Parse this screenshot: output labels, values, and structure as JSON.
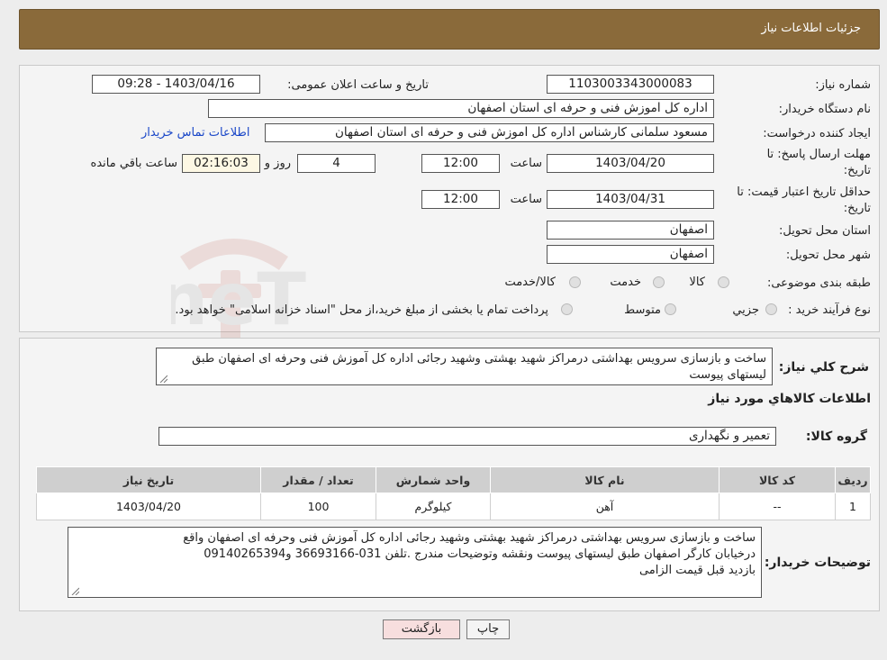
{
  "header": {
    "title": "جزئیات اطلاعات نیاز"
  },
  "form": {
    "need_number_label": "شماره نیاز:",
    "need_number": "1103003343000083",
    "announce_label": "تاریخ و ساعت اعلان عمومی:",
    "announce_value": "1403/04/16 - 09:28",
    "buyer_org_label": "نام دستگاه خریدار:",
    "buyer_org": "اداره کل اموزش فنی و حرفه ای استان اصفهان",
    "creator_label": "ایجاد کننده درخواست:",
    "creator": "مسعود سلمانی کارشناس اداره کل اموزش فنی و حرفه ای استان اصفهان",
    "contact_link": "اطلاعات تماس خریدار",
    "deadline_label_1": "مهلت ارسال پاسخ: تا",
    "deadline_label_2": "تاریخ:",
    "deadline_date": "1403/04/20",
    "time_label": "ساعت",
    "deadline_time": "12:00",
    "days_value": "4",
    "days_label": "روز و",
    "remaining_time": "02:16:03",
    "remaining_label": "ساعت باقي مانده",
    "validity_label_1": "حداقل تاریخ اعتبار قیمت: تا",
    "validity_label_2": "تاریخ:",
    "validity_date": "1403/04/31",
    "validity_time": "12:00",
    "province_label": "استان محل تحویل:",
    "province": "اصفهان",
    "city_label": "شهر محل تحویل:",
    "city": "اصفهان",
    "category_label": "طبقه بندی موضوعی:",
    "category_options": [
      "کالا",
      "خدمت",
      "کالا/خدمت"
    ],
    "process_label": "نوع فرآیند خرید :",
    "process_options": [
      "جزیي",
      "متوسط"
    ],
    "process_note": "پرداخت تمام یا بخشی از مبلغ خرید،از محل \"اسناد خزانه اسلامی\" خواهد بود."
  },
  "description": {
    "label": "شرح کلي نياز:",
    "text": "ساخت و بازسازی سرویس بهداشتی درمراکز شهید بهشتی وشهید رجائی اداره کل آموزش فنی وحرفه ای اصفهان طبق لیستهای پیوست"
  },
  "goods": {
    "section_title": "اطلاعات کالاهاي مورد نياز",
    "group_label": "گروه کالا:",
    "group_value": "تعمیر و نگهداری",
    "columns": [
      "رديف",
      "کد کالا",
      "نام کالا",
      "واحد شمارش",
      "تعداد / مقدار",
      "تاريخ نياز"
    ],
    "rows": [
      [
        "1",
        "--",
        "آهن",
        "کیلوگرم",
        "100",
        "1403/04/20"
      ]
    ]
  },
  "buyer_notes": {
    "label": "توضیحات خریدار:",
    "line1": "ساخت و بازسازی سرویس بهداشتی درمراکز شهید بهشتی وشهید رجائی اداره کل آموزش فنی وحرفه ای اصفهان واقع",
    "line2": "درخیابان کارگر اصفهان طبق لیستهای پیوست ونقشه وتوضیحات مندرج .تلفن 031-36693166 و09140265394",
    "line3": "بازدید قبل قیمت الزامی"
  },
  "buttons": {
    "print": "چاپ",
    "back": "بازگشت"
  },
  "colors": {
    "header_bg": "#8a6a3a",
    "link": "#1a47c8",
    "back_button_bg": "#f7dede"
  },
  "watermark_text": "AriaTender.neT"
}
